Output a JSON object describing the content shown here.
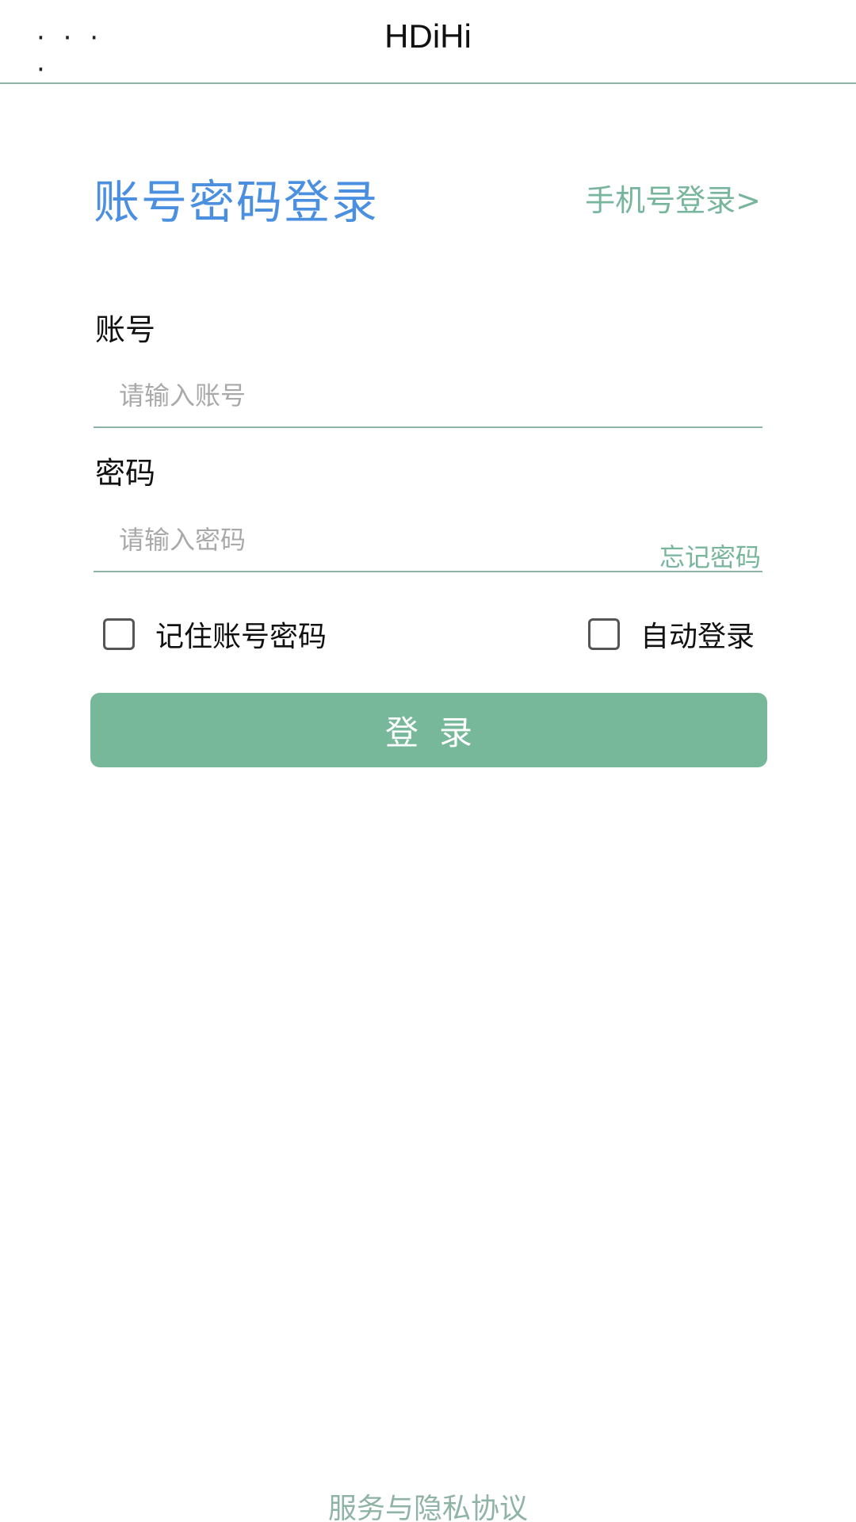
{
  "header": {
    "menu_dots": "· · · ·",
    "title": "HDiHi"
  },
  "login": {
    "title": "账号密码登录",
    "phone_login_link": "手机号登录>",
    "account_label": "账号",
    "account_value": "",
    "account_placeholder": "请输入账号",
    "password_label": "密码",
    "password_value": "",
    "password_placeholder": "请输入密码",
    "forgot_password": "忘记密码",
    "remember_label": "记住账号密码",
    "remember_checked": false,
    "auto_login_label": "自动登录",
    "auto_login_checked": false,
    "submit_label": "登录"
  },
  "footer": {
    "agreement": "服务与隐私协议"
  },
  "colors": {
    "title_blue": "#4b8fe0",
    "accent_green": "#77b79a",
    "divider": "#8fb3a4"
  }
}
